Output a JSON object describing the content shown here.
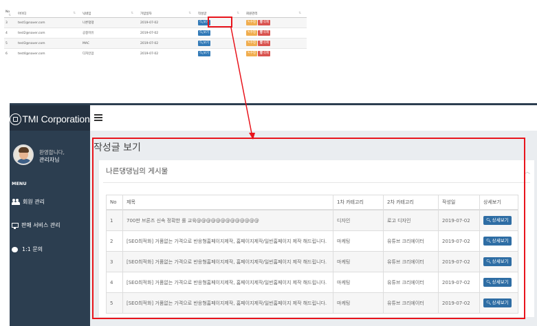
{
  "member_table": {
    "headers": [
      "No",
      "아이디",
      "닉네임",
      "가입일자",
      "작성글",
      "회원관리"
    ],
    "rows": [
      {
        "no": "3",
        "id": "test1@naver.com",
        "nickname": "나른댕댕",
        "date": "2019-07-02"
      },
      {
        "no": "4",
        "id": "test2@naver.com",
        "nickname": "공중미유",
        "date": "2019-07-02"
      },
      {
        "no": "5",
        "id": "test3@naver.com",
        "nickname": "MAC",
        "date": "2019-07-02"
      },
      {
        "no": "6",
        "id": "test4@naver.com",
        "nickname": "디자인맘",
        "date": "2019-07-02"
      }
    ],
    "view_label": "보기",
    "edit_label": "수정",
    "delete_label": "삭제"
  },
  "brand": {
    "name": "TMI Corporation"
  },
  "sidebar": {
    "welcome": "환영합니다,",
    "admin_name": "관리자님",
    "menu_header": "MENU",
    "items": [
      {
        "label": "회원 관리",
        "icon": "users-icon"
      },
      {
        "label": "판매 서비스 관리",
        "icon": "monitor-icon"
      },
      {
        "label": "1:1 문의",
        "icon": "chat-icon"
      }
    ]
  },
  "content": {
    "page_title": "작성글 보기",
    "panel_title": "나른댕댕님의 게시물",
    "columns": [
      "No",
      "제목",
      "1차 카테고리",
      "2차 카테고리",
      "작성일",
      "상세보기"
    ],
    "detail_label": "상세보기",
    "rows": [
      {
        "no": "1",
        "title": "700판 브론즈 신속 정확한 롤 교육@@@@@@@@@@@@@",
        "cat1": "디자인",
        "cat2": "로고 디자인",
        "date": "2019-07-02"
      },
      {
        "no": "2",
        "title": "[SEO최적화] 거품없는 가격으로 반응형홈페이지제작, 홈페이지제작/일반홈페이지 제작 해드립니다.",
        "cat1": "마케팅",
        "cat2": "유튜브 크리에이터",
        "date": "2019-07-02"
      },
      {
        "no": "3",
        "title": "[SEO최적화] 거품없는 가격으로 반응형홈페이지제작, 홈페이지제작/일반홈페이지 제작 해드립니다.",
        "cat1": "마케팅",
        "cat2": "유튜브 크리에이터",
        "date": "2019-07-02"
      },
      {
        "no": "4",
        "title": "[SEO최적화] 거품없는 가격으로 반응형홈페이지제작, 홈페이지제작/일반홈페이지 제작 해드립니다.",
        "cat1": "마케팅",
        "cat2": "유튜브 크리에이터",
        "date": "2019-07-02"
      },
      {
        "no": "5",
        "title": "[SEO최적화] 거품없는 가격으로 반응형홈페이지제작, 홈페이지제작/일반홈페이지 제작 해드립니다.",
        "cat1": "마케팅",
        "cat2": "유튜브 크리에이터",
        "date": "2019-07-02"
      }
    ]
  },
  "colors": {
    "accent_red": "#e8131b",
    "sidebar_bg": "#2c3e50",
    "button_blue": "#2e6da4"
  }
}
